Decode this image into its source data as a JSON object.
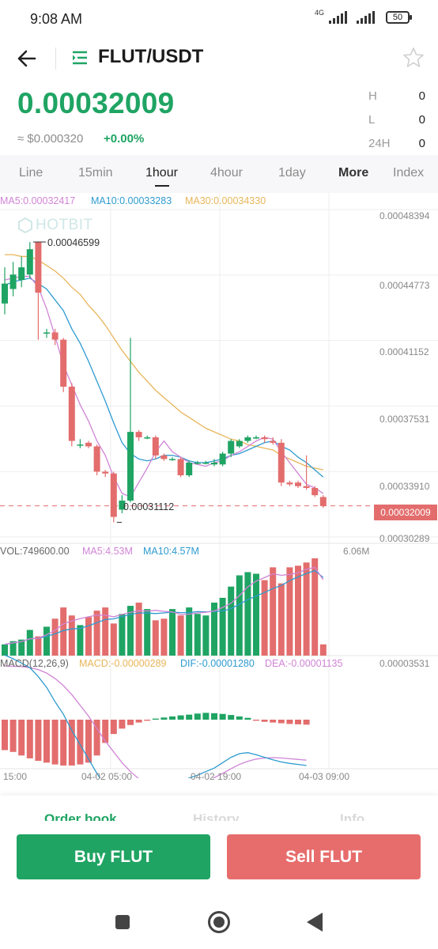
{
  "status": {
    "time": "9:08 AM",
    "network": "4G",
    "battery": "50"
  },
  "header": {
    "pair": "FLUT/USDT",
    "icons": [
      "arrow-left-icon",
      "list-icon",
      "star-icon"
    ]
  },
  "price": {
    "last": "0.00032009",
    "usd": "≈ $0.000320",
    "change": "+0.00%"
  },
  "stats": [
    {
      "label": "H",
      "value": "0"
    },
    {
      "label": "L",
      "value": "0"
    },
    {
      "label": "24H",
      "value": "0"
    }
  ],
  "tabs": [
    "Line",
    "15min",
    "1hour",
    "4hour",
    "1day",
    "More",
    "Index"
  ],
  "indicators": {
    "ma5": "MA5:0.00032417",
    "ma10": "MA10:0.00033283",
    "ma30": "MA30:0.00034330",
    "vol": "VOL:749600.00",
    "vol_ma5": "MA5:4.53M",
    "vol_ma10": "MA10:4.57M",
    "macd_title": "MACD(12,26,9)",
    "macd": "MACD:-0.00000289",
    "dif": "DIF:-0.00001280",
    "dea": "DEA:-0.00001135"
  },
  "watermark": "HOTBIT",
  "chart_data": {
    "type": "candlestick",
    "price_axis": [
      "0.00048394",
      "0.00044773",
      "0.00041152",
      "0.00037531",
      "0.00033910",
      "0.00030289"
    ],
    "current_price_tag": "0.00032009",
    "high_label": "0.00046599",
    "low_label": "0.00031112",
    "volume_max": "6.06M",
    "macd_axis_top": "0.00003531",
    "time_axis": [
      "15:00",
      "04-02 05:00",
      "04-02 19:00",
      "04-03 09:00"
    ],
    "candles": [
      {
        "o": 0.000432,
        "c": 0.000443,
        "h": 0.000452,
        "l": 0.000426
      },
      {
        "o": 0.00044,
        "c": 0.000448,
        "h": 0.000455,
        "l": 0.000436
      },
      {
        "o": 0.000445,
        "c": 0.000452,
        "h": 0.000458,
        "l": 0.000441
      },
      {
        "o": 0.000448,
        "c": 0.000462,
        "h": 0.000466,
        "l": 0.000446
      },
      {
        "o": 0.000466,
        "c": 0.000438,
        "h": 0.000466,
        "l": 0.000412
      },
      {
        "o": 0.000416,
        "c": 0.000416,
        "h": 0.000418,
        "l": 0.000413
      },
      {
        "o": 0.000416,
        "c": 0.000412,
        "h": 0.000418,
        "l": 0.000409
      },
      {
        "o": 0.000412,
        "c": 0.000386,
        "h": 0.000413,
        "l": 0.000383
      },
      {
        "o": 0.000386,
        "c": 0.000356,
        "h": 0.000388,
        "l": 0.000353
      },
      {
        "o": 0.000354,
        "c": 0.000354,
        "h": 0.000357,
        "l": 0.000352
      },
      {
        "o": 0.000355,
        "c": 0.000353,
        "h": 0.000356,
        "l": 0.000352
      },
      {
        "o": 0.000353,
        "c": 0.000339,
        "h": 0.000354,
        "l": 0.000337
      },
      {
        "o": 0.000339,
        "c": 0.000338,
        "h": 0.00034,
        "l": 0.000336
      },
      {
        "o": 0.000338,
        "c": 0.000314,
        "h": 0.000339,
        "l": 0.000311
      },
      {
        "o": 0.000318,
        "c": 0.000323,
        "h": 0.000326,
        "l": 0.000316
      },
      {
        "o": 0.000323,
        "c": 0.000361,
        "h": 0.000413,
        "l": 0.000322
      },
      {
        "o": 0.000361,
        "c": 0.000358,
        "h": 0.000362,
        "l": 0.000356
      },
      {
        "o": 0.000358,
        "c": 0.000358,
        "h": 0.000359,
        "l": 0.000357
      },
      {
        "o": 0.000358,
        "c": 0.000348,
        "h": 0.000359,
        "l": 0.000346
      },
      {
        "o": 0.000348,
        "c": 0.000346,
        "h": 0.000349,
        "l": 0.000345
      },
      {
        "o": 0.000346,
        "c": 0.000346,
        "h": 0.000347,
        "l": 0.000345
      },
      {
        "o": 0.000346,
        "c": 0.000337,
        "h": 0.000347,
        "l": 0.000336
      },
      {
        "o": 0.000337,
        "c": 0.000344,
        "h": 0.000345,
        "l": 0.000336
      },
      {
        "o": 0.000344,
        "c": 0.000344,
        "h": 0.000345,
        "l": 0.000343
      },
      {
        "o": 0.000344,
        "c": 0.000344,
        "h": 0.000345,
        "l": 0.000343
      },
      {
        "o": 0.000343,
        "c": 0.000344,
        "h": 0.000346,
        "l": 0.000342
      },
      {
        "o": 0.000343,
        "c": 0.000349,
        "h": 0.00035,
        "l": 0.000342
      },
      {
        "o": 0.000349,
        "c": 0.000356,
        "h": 0.000357,
        "l": 0.000347
      },
      {
        "o": 0.000353,
        "c": 0.000356,
        "h": 0.000357,
        "l": 0.000352
      },
      {
        "o": 0.000356,
        "c": 0.000358,
        "h": 0.000359,
        "l": 0.000355
      },
      {
        "o": 0.000358,
        "c": 0.000358,
        "h": 0.000359,
        "l": 0.000357
      },
      {
        "o": 0.000358,
        "c": 0.000357,
        "h": 0.000359,
        "l": 0.000355
      },
      {
        "o": 0.000356,
        "c": 0.000355,
        "h": 0.000358,
        "l": 0.000354
      },
      {
        "o": 0.000355,
        "c": 0.000333,
        "h": 0.000357,
        "l": 0.000331
      },
      {
        "o": 0.000333,
        "c": 0.000332,
        "h": 0.000334,
        "l": 0.000331
      },
      {
        "o": 0.000333,
        "c": 0.000331,
        "h": 0.000334,
        "l": 0.00033
      },
      {
        "o": 0.000331,
        "c": 0.00033,
        "h": 0.000348,
        "l": 0.000329
      },
      {
        "o": 0.00033,
        "c": 0.000326,
        "h": 0.000331,
        "l": 0.000325
      },
      {
        "o": 0.000325,
        "c": 0.00032,
        "h": 0.000326,
        "l": 0.000319
      }
    ],
    "ma5": [
      0.000445,
      0.000446,
      0.000447,
      0.000447,
      0.000441,
      0.000429,
      0.000414,
      0.000398,
      0.000387,
      0.000376,
      0.000367,
      0.000356,
      0.000348,
      0.000336,
      0.000327,
      0.000325,
      0.000333,
      0.000341,
      0.00035,
      0.000356,
      0.00035,
      0.000347,
      0.000344,
      0.000343,
      0.000342,
      0.000344,
      0.000345,
      0.000348,
      0.00035,
      0.000353,
      0.000356,
      0.000358,
      0.000357,
      0.00035,
      0.000344,
      0.000338,
      0.000332,
      0.00033,
      0.000327
    ],
    "ma10": [
      0.000442,
      0.000444,
      0.000445,
      0.000446,
      0.000443,
      0.00044,
      0.000434,
      0.000428,
      0.000418,
      0.00041,
      0.0004,
      0.000389,
      0.000378,
      0.000366,
      0.000355,
      0.000349,
      0.000346,
      0.000345,
      0.000346,
      0.000348,
      0.000348,
      0.000347,
      0.000345,
      0.000344,
      0.000344,
      0.000345,
      0.000346,
      0.000348,
      0.000349,
      0.000351,
      0.000353,
      0.000355,
      0.000356,
      0.000353,
      0.000351,
      0.000347,
      0.000344,
      0.00034,
      0.000336
    ],
    "ma30": [
      0.000459,
      0.000459,
      0.000458,
      0.000458,
      0.000456,
      0.000453,
      0.00045,
      0.000446,
      0.000441,
      0.000437,
      0.000431,
      0.000426,
      0.00042,
      0.000413,
      0.000406,
      0.0004,
      0.000394,
      0.000389,
      0.000384,
      0.00038,
      0.000376,
      0.000372,
      0.000369,
      0.000366,
      0.000363,
      0.000361,
      0.000359,
      0.000357,
      0.000356,
      0.000354,
      0.000353,
      0.000352,
      0.000351,
      0.000348,
      0.000346,
      0.000344,
      0.000342,
      0.000341,
      0.00034
    ],
    "volumes": [
      0.7,
      0.9,
      1.0,
      1.6,
      1.2,
      1.8,
      2.3,
      3.0,
      2.5,
      1.9,
      2.4,
      2.8,
      3.0,
      2.0,
      2.6,
      3.1,
      3.3,
      2.9,
      2.2,
      2.3,
      2.9,
      2.5,
      3.0,
      2.6,
      2.5,
      3.3,
      3.6,
      4.3,
      5.0,
      5.2,
      5.1,
      4.7,
      5.5,
      4.5,
      5.5,
      5.6,
      5.8,
      6.06,
      0.7
    ],
    "macd_hist": [
      -8.5e-06,
      -9e-06,
      -1e-05,
      -1.08e-05,
      -1.15e-05,
      -1.2e-05,
      -1.25e-05,
      -1.28e-05,
      -1.28e-05,
      -1.25e-05,
      -1.2e-05,
      -1e-05,
      -6.5e-06,
      -4e-06,
      -2.5e-06,
      -1.5e-06,
      -8e-07,
      -3e-07,
      3e-07,
      6e-07,
      9e-07,
      1.2e-06,
      1.4e-06,
      1.7e-06,
      1.9e-06,
      1.8e-06,
      1.6e-06,
      1.3e-06,
      9e-07,
      5e-07,
      -3e-07,
      -6e-07,
      -8e-07,
      -1e-06,
      -1.2e-06,
      -1.3e-06,
      -1.4e-06
    ],
    "dif": [
      1.8e-05,
      1.7e-05,
      1.58e-05,
      1.45e-05,
      1.2e-05,
      9e-06,
      5e-06,
      1.5e-06,
      -3e-06,
      -7e-06,
      -1.1e-05,
      -1.5e-05,
      -1.85e-05,
      -2.1e-05,
      -2.25e-05,
      -2.25e-05,
      -2.2e-05,
      -2.1e-05,
      -2e-05,
      -1.9e-05,
      -1.8e-05,
      -1.72e-05,
      -1.63e-05,
      -1.55e-05,
      -1.45e-05,
      -1.35e-05,
      -1.2e-05,
      -1.05e-05,
      -9.5e-06,
      -9.2e-06,
      -9.8e-06,
      -1.05e-05,
      -1.12e-05,
      -1.18e-05,
      -1.22e-05,
      -1.25e-05,
      -1.28e-05
    ],
    "dea": [
      1.5e-05,
      1.49e-05,
      1.48e-05,
      1.45e-05,
      1.4e-05,
      1.3e-05,
      1.15e-05,
      9.5e-06,
      7e-06,
      4e-06,
      1e-06,
      -2.5e-06,
      -6e-06,
      -9e-06,
      -1.2e-05,
      -1.45e-05,
      -1.65e-05,
      -1.8e-05,
      -1.9e-05,
      -1.95e-05,
      -1.95e-05,
      -1.9e-05,
      -1.85e-05,
      -1.8e-05,
      -1.72e-05,
      -1.62e-05,
      -1.5e-05,
      -1.37e-05,
      -1.25e-05,
      -1.16e-05,
      -1.1e-05,
      -1.07e-05,
      -1.06e-05,
      -1.07e-05,
      -1.09e-05,
      -1.11e-05,
      -1.13e-05
    ]
  },
  "bottom_tabs": [
    "Order book",
    "History",
    "Info"
  ],
  "actions": {
    "buy": "Buy FLUT",
    "sell": "Sell FLUT"
  },
  "colors": {
    "up": "#1fa463",
    "down": "#e36d6d",
    "ma5": "#d084d6",
    "ma10": "#2e9bd0",
    "ma30": "#e8b55a"
  }
}
